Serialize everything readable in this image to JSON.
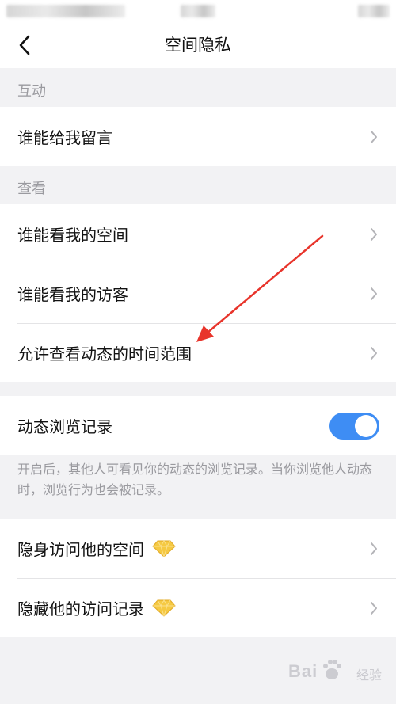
{
  "nav": {
    "title": "空间隐私"
  },
  "sections": {
    "interaction": {
      "label": "互动",
      "items": [
        {
          "label": "谁能给我留言"
        }
      ]
    },
    "view": {
      "label": "查看",
      "items": [
        {
          "label": "谁能看我的空间"
        },
        {
          "label": "谁能看我的访客"
        },
        {
          "label": "允许查看动态的时间范围"
        }
      ]
    },
    "browse": {
      "toggle_label": "动态浏览记录",
      "toggle_on": true,
      "description": "开启后，其他人可看见你的动态的浏览记录。当你浏览他人动态时，浏览行为也会被记录。"
    },
    "vip": {
      "items": [
        {
          "label": "隐身访问他的空间",
          "icon": "diamond-icon"
        },
        {
          "label": "隐藏他的访问记录",
          "icon": "diamond-icon"
        }
      ]
    }
  },
  "colors": {
    "accent": "#3e8df4",
    "annotation_arrow": "#e8342b",
    "gem": "#f5c942"
  },
  "watermark": {
    "text": "Bai",
    "sub": "经验"
  }
}
